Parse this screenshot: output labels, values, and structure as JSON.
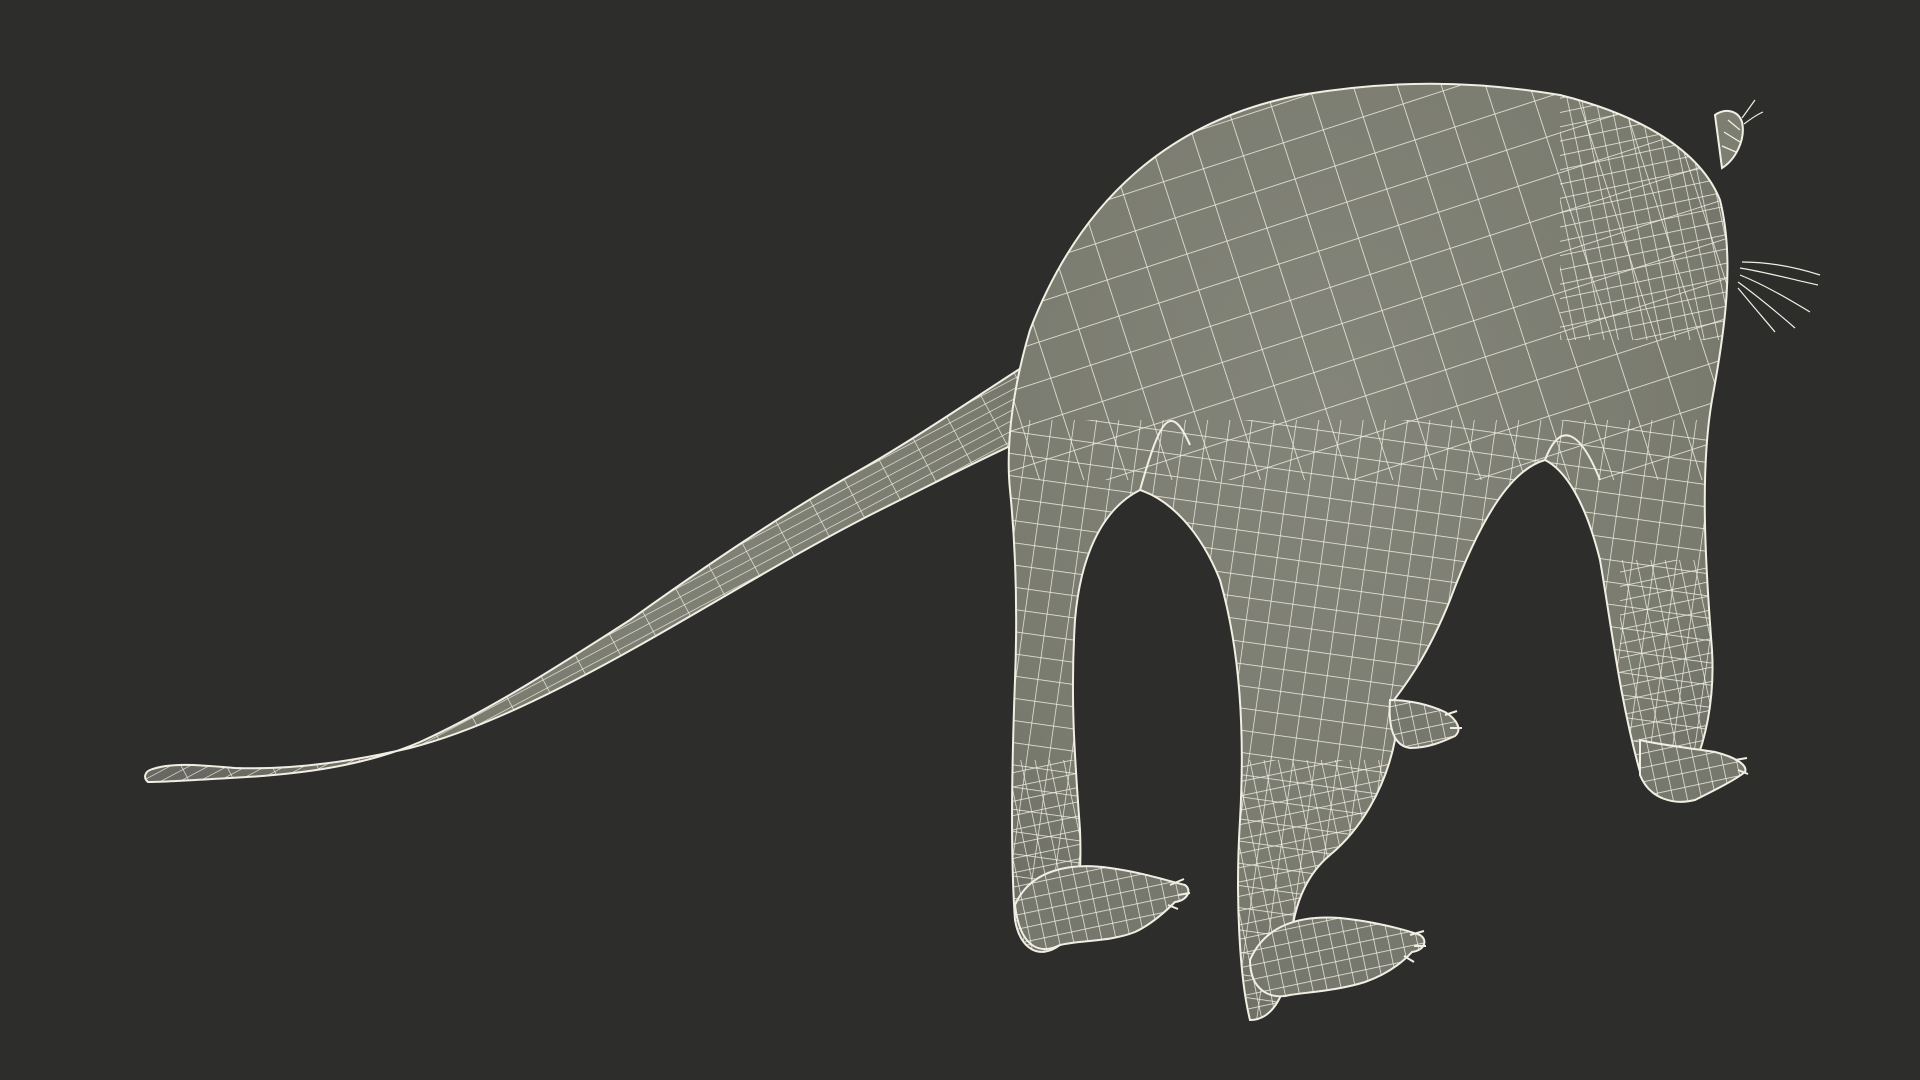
{
  "scene": {
    "background_color": "#2d2d2b",
    "mesh_fill_color": "#7c7d70",
    "mesh_shadow_color": "#66675c",
    "wire_color": "#f1efe4",
    "subject": "wireframe-quadruped-with-long-tail",
    "view": "rear-three-quarter",
    "render_style": "shaded-wireframe"
  }
}
